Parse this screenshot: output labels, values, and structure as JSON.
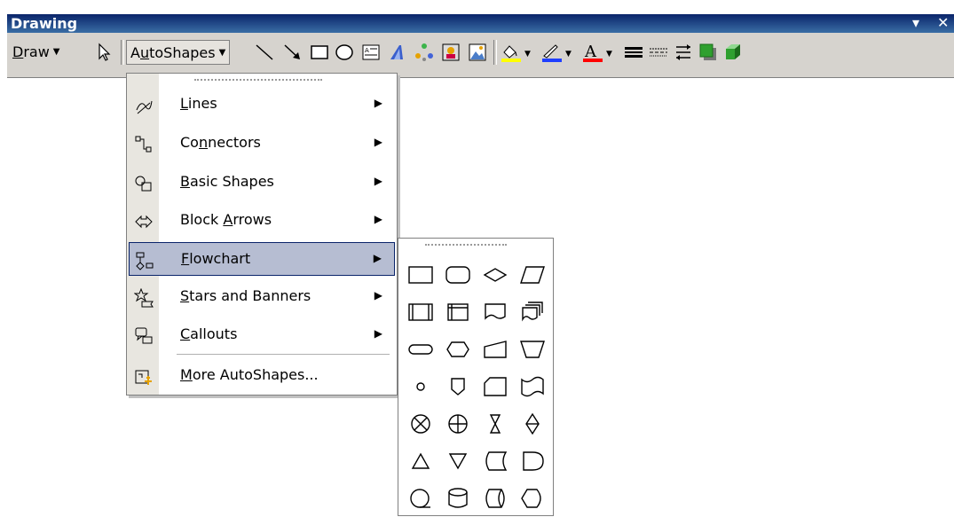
{
  "toolbar": {
    "title": "Drawing",
    "draw_label": "Draw",
    "autoshapes_label": "AutoShapes"
  },
  "menu": {
    "items": [
      {
        "label": "Lines",
        "icon": "lines-icon",
        "submenu": true
      },
      {
        "label": "Connectors",
        "icon": "connectors-icon",
        "submenu": true
      },
      {
        "label": "Basic Shapes",
        "icon": "basic-shapes-icon",
        "submenu": true
      },
      {
        "label": "Block Arrows",
        "icon": "block-arrows-icon",
        "submenu": true
      },
      {
        "label": "Flowchart",
        "icon": "flowchart-icon",
        "submenu": true,
        "selected": true
      },
      {
        "label": "Stars and Banners",
        "icon": "stars-banners-icon",
        "submenu": true
      },
      {
        "label": "Callouts",
        "icon": "callouts-icon",
        "submenu": true
      },
      {
        "label": "More AutoShapes...",
        "icon": "more-autoshapes-icon",
        "submenu": false
      }
    ]
  },
  "submenu": {
    "shapes": [
      [
        "process",
        "alternate-process",
        "decision",
        "data"
      ],
      [
        "predefined-process",
        "internal-storage",
        "document",
        "multidocument"
      ],
      [
        "terminator",
        "preparation",
        "manual-input",
        "manual-operation"
      ],
      [
        "connector",
        "off-page-connector",
        "card",
        "punched-tape"
      ],
      [
        "summing-junction",
        "or",
        "collate",
        "sort"
      ],
      [
        "extract",
        "merge",
        "stored-data",
        "delay"
      ],
      [
        "sequential-access-storage",
        "magnetic-disk",
        "direct-access-storage",
        "display"
      ]
    ]
  },
  "colors": {
    "title_bar": "#0a246a",
    "toolbar_bg": "#d6d3ce",
    "menu_selected_bg": "#b6bdd2",
    "menu_selected_border": "#0a246a"
  }
}
